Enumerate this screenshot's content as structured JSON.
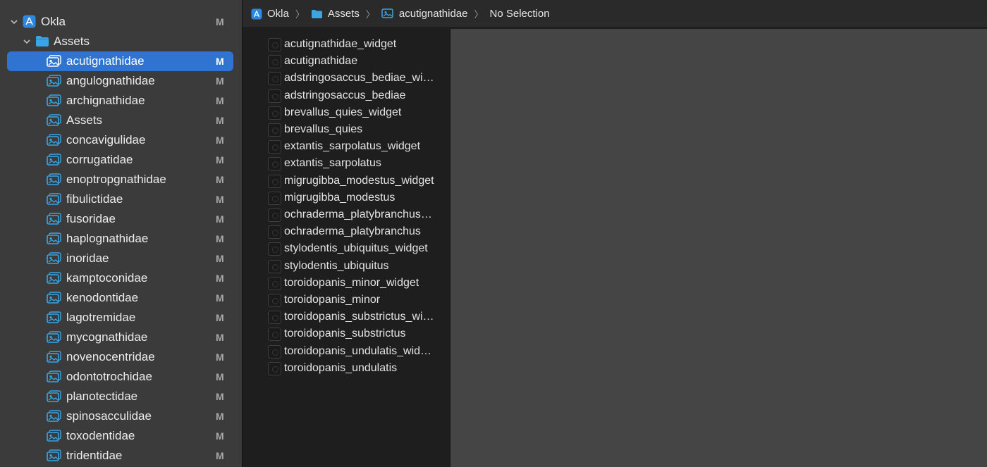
{
  "navigator": {
    "project": {
      "label": "Okla",
      "badge": "M"
    },
    "folder": {
      "label": "Assets"
    },
    "items": [
      {
        "label": "acutignathidae",
        "badge": "M",
        "selected": true
      },
      {
        "label": "angulognathidae",
        "badge": "M"
      },
      {
        "label": "archignathidae",
        "badge": "M"
      },
      {
        "label": "Assets",
        "badge": "M"
      },
      {
        "label": "concavigulidae",
        "badge": "M"
      },
      {
        "label": "corrugatidae",
        "badge": "M"
      },
      {
        "label": "enoptropgnathidae",
        "badge": "M"
      },
      {
        "label": "fibulictidae",
        "badge": "M"
      },
      {
        "label": "fusoridae",
        "badge": "M"
      },
      {
        "label": "haplognathidae",
        "badge": "M"
      },
      {
        "label": "inoridae",
        "badge": "M"
      },
      {
        "label": "kamptoconidae",
        "badge": "M"
      },
      {
        "label": "kenodontidae",
        "badge": "M"
      },
      {
        "label": "lagotremidae",
        "badge": "M"
      },
      {
        "label": "mycognathidae",
        "badge": "M"
      },
      {
        "label": "novenocentridae",
        "badge": "M"
      },
      {
        "label": "odontotrochidae",
        "badge": "M"
      },
      {
        "label": "planotectidae",
        "badge": "M"
      },
      {
        "label": "spinosacculidae",
        "badge": "M"
      },
      {
        "label": "toxodentidae",
        "badge": "M"
      },
      {
        "label": "tridentidae",
        "badge": "M"
      }
    ]
  },
  "jumpbar": {
    "crumbs": [
      "Okla",
      "Assets",
      "acutignathidae",
      "No Selection"
    ]
  },
  "assets": [
    "acutignathidae_widget",
    "acutignathidae",
    "adstringosaccus_bediae_widget",
    "adstringosaccus_bediae",
    "brevallus_quies_widget",
    "brevallus_quies",
    "extantis_sarpolatus_widget",
    "extantis_sarpolatus",
    "migrugibba_modestus_widget",
    "migrugibba_modestus",
    "ochraderma_platybranchus_widget",
    "ochraderma_platybranchus",
    "stylodentis_ubiquitus_widget",
    "stylodentis_ubiquitus",
    "toroidopanis_minor_widget",
    "toroidopanis_minor",
    "toroidopanis_substrictus_widget",
    "toroidopanis_substrictus",
    "toroidopanis_undulatis_widget",
    "toroidopanis_undulatis"
  ],
  "colors": {
    "accent": "#2f74d0",
    "icon_blue": "#3aa3e3",
    "sidebar": "#3b3b3b",
    "detail": "#454545"
  }
}
